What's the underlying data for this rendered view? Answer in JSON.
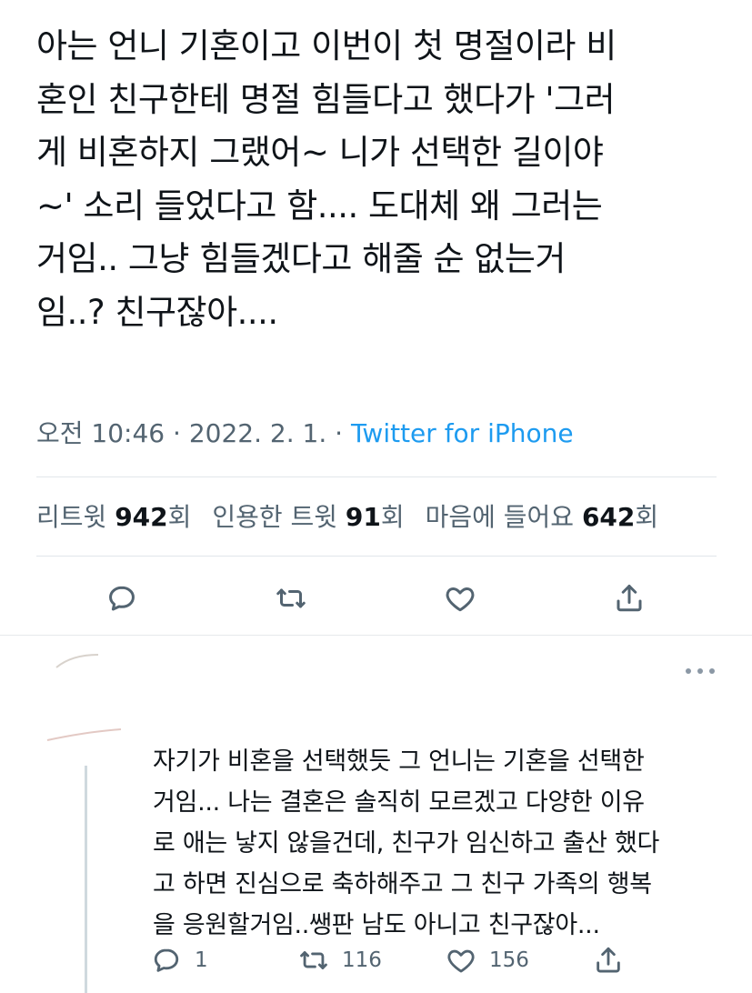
{
  "tweet": {
    "text": "아는 언니 기혼이고 이번이 첫 명절이라 비\n혼인 친구한테 명절 힘들다고 했다가 '그러\n게 비혼하지 그랬어~ 니가 선택한 길이야\n~'  소리 들었다고 함.... 도대체 왜 그러는\n거임.. 그냥 힘들겠다고 해줄 순 없는거\n임..? 친구잖아....",
    "time": "오전 10:46",
    "sep": "·",
    "date": "2022. 2. 1.",
    "source": "Twitter for iPhone"
  },
  "stats": {
    "retweets_label": "리트윗",
    "retweets_count": "942",
    "retweets_suffix": "회",
    "quotes_label": "인용한 트윗",
    "quotes_count": "91",
    "quotes_suffix": "회",
    "likes_label": "마음에 들어요",
    "likes_count": "642",
    "likes_suffix": "회"
  },
  "actions": {
    "icons": [
      "reply-icon",
      "retweet-icon",
      "like-icon",
      "share-icon"
    ]
  },
  "reply": {
    "text": "자기가 비혼을 선택했듯 그 언니는 기혼을 선택한\n거임... 나는 결혼은 솔직히 모르겠고 다양한 이유\n로 애는 낳지 않을건데, 친구가 임신하고 출산 했다\n고 하면 진심으로 축하해주고 그 친구 가족의 행복\n을 응원할거임..쌩판 남도 아니고 친구잖아...",
    "reply_count": "1",
    "retweet_count": "116",
    "like_count": "156"
  },
  "colors": {
    "text": "#0f1419",
    "secondary": "#536471",
    "accent": "#1d9bf0",
    "divider": "#e1e6ea"
  }
}
